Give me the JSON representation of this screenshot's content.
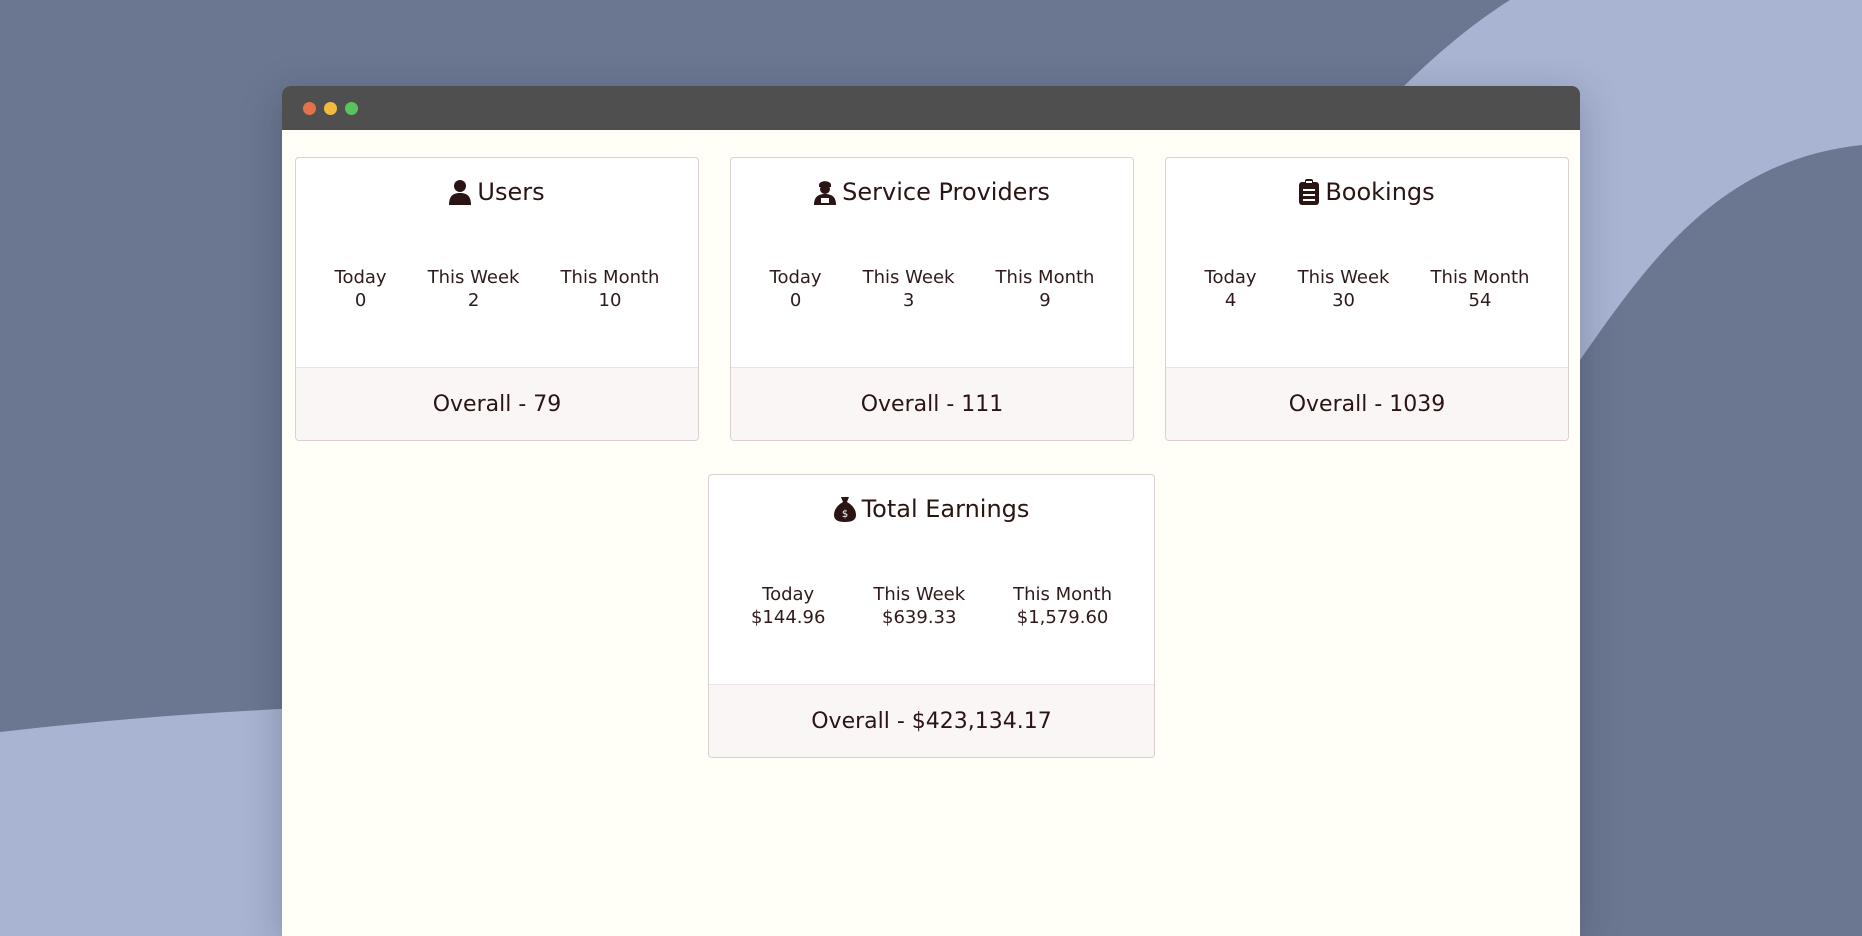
{
  "window": {
    "dots": [
      "#e0734a",
      "#f2bb40",
      "#5bc35b"
    ]
  },
  "cards": {
    "users": {
      "title": "Users",
      "icon": "user-icon",
      "today_label": "Today",
      "today_value": "0",
      "week_label": "This Week",
      "week_value": "2",
      "month_label": "This Month",
      "month_value": "10",
      "overall": "Overall - 79"
    },
    "providers": {
      "title": "Service Providers",
      "icon": "service-provider-icon",
      "today_label": "Today",
      "today_value": "0",
      "week_label": "This Week",
      "week_value": "3",
      "month_label": "This Month",
      "month_value": "9",
      "overall": "Overall - 111"
    },
    "bookings": {
      "title": "Bookings",
      "icon": "clipboard-icon",
      "today_label": "Today",
      "today_value": "4",
      "week_label": "This Week",
      "week_value": "30",
      "month_label": "This Month",
      "month_value": "54",
      "overall": "Overall - 1039"
    },
    "earnings": {
      "title": "Total Earnings",
      "icon": "money-bag-icon",
      "today_label": "Today",
      "today_value": "$144.96",
      "week_label": "This Week",
      "week_value": "$639.33",
      "month_label": "This Month",
      "month_value": "$1,579.60",
      "overall": "Overall - $423,134.17"
    }
  }
}
